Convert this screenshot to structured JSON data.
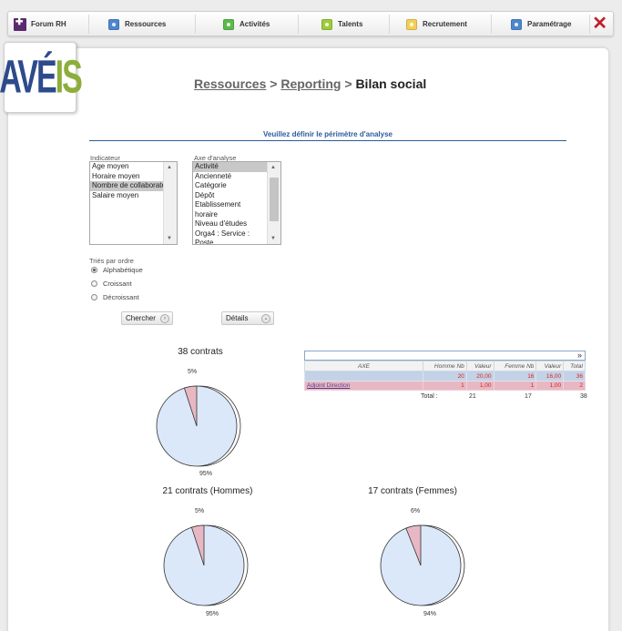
{
  "nav": {
    "items": [
      {
        "label": "Forum RH",
        "color": "#5a2a6e"
      },
      {
        "label": "Ressources",
        "color": "#4d86cf"
      },
      {
        "label": "Activités",
        "color": "#5cba4a"
      },
      {
        "label": "Talents",
        "color": "#9ccc3a"
      },
      {
        "label": "Recrutement",
        "color": "#f3cf58"
      },
      {
        "label": "Paramétrage",
        "color": "#4d86cf"
      }
    ],
    "close_icon": "close-x-icon"
  },
  "logo": {
    "text_main": "AVÉ",
    "text_accent": "IS"
  },
  "breadcrumb": {
    "part1": "Ressources",
    "part2": "Reporting",
    "current": "Bilan social",
    "sep": ">"
  },
  "section_title": "Veuillez définir le périmètre d'analyse",
  "indicateur": {
    "label": "Indicateur",
    "options": [
      "Age moyen",
      "Horaire moyen",
      "Nombre de collaborate",
      "Salaire moyen"
    ],
    "selected_index": 2
  },
  "axe": {
    "label": "Axe d'analyse",
    "options": [
      "Activité",
      "Ancienneté",
      "Catégorie",
      "Dépôt",
      "Etablissement",
      "horaire",
      "Niveau d'études",
      "Orga4 : Service :",
      "Poste"
    ],
    "selected_index": 0
  },
  "tri": {
    "label": "Triés par ordre",
    "options": [
      "Alphabétique",
      "Croissant",
      "Décroissant"
    ],
    "selected_index": 0
  },
  "buttons": {
    "chercher": "Chercher",
    "details": "Détails"
  },
  "pies": [
    {
      "title": "38 contrats",
      "small_pct": "5%",
      "big_pct": "95%"
    },
    {
      "title": "21 contrats (Hommes)",
      "small_pct": "5%",
      "big_pct": "95%"
    },
    {
      "title": "17 contrats (Femmes)",
      "small_pct": "6%",
      "big_pct": "94%"
    }
  ],
  "table": {
    "columns": [
      "AXE",
      "Homme Nb",
      "Valeur",
      "Femme Nb",
      "Valeur",
      "Total"
    ],
    "rows": [
      [
        "",
        "20",
        "20,00",
        "16",
        "16,00",
        "36"
      ],
      [
        "Adjoint Direction",
        "1",
        "1,00",
        "1",
        "1,00",
        "2"
      ]
    ],
    "total_label": "Total :",
    "totals": [
      "21",
      "17",
      "38"
    ]
  },
  "colors": {
    "pie_main": "#dbe8f9",
    "pie_slice": "#e7b8c3",
    "title_blue": "#2b5c9c"
  }
}
